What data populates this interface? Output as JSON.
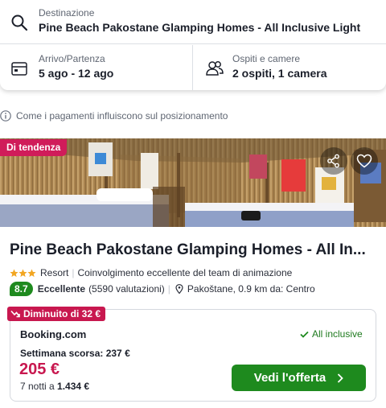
{
  "search": {
    "destination_label": "Destinazione",
    "destination_value": "Pine Beach Pakostane Glamping Homes - All Inclusive Light",
    "dates_label": "Arrivo/Partenza",
    "dates_value": "5 ago - 12 ago",
    "guests_label": "Ospiti e camere",
    "guests_value": "2 ospiti, 1 camera"
  },
  "info_note": "Come i pagamenti influiscono sul posizionamento",
  "hotel": {
    "trend_badge": "Di tendenza",
    "name": "Pine Beach Pakostane Glamping Homes - All In...",
    "stars": 3,
    "type": "Resort",
    "highlight": "Coinvolgimento eccellente del team di animazione",
    "rating_score": "8.7",
    "rating_label": "Eccellente",
    "rating_count": "(5590 valutazioni)",
    "location": "Pakoštane, 0.9 km da: Centro"
  },
  "deal": {
    "drop_badge": "Diminuito di 32 €",
    "provider": "Booking.com",
    "board": "All inclusive",
    "last_week": "Settimana scorsa: 237 €",
    "price": "205 €",
    "nights_prefix": "7 notti a",
    "nights_total": "1.434 €",
    "cta": "Vedi l'offerta"
  },
  "colors": {
    "accent_green": "#1e8a1e",
    "badge_red": "#c8184f",
    "trend_pink": "#d01c5a"
  }
}
